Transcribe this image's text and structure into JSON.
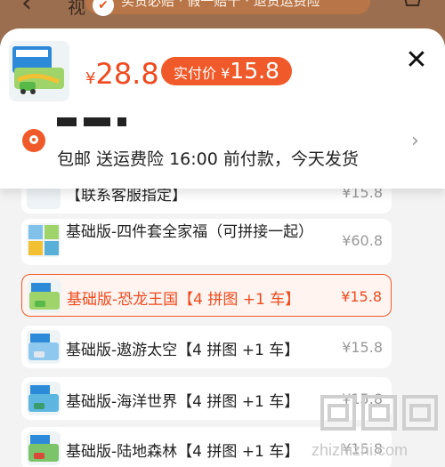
{
  "background": {
    "back_icon": "back-arrow-icon",
    "title_fragment": "视",
    "banner_text": "买贵必赔 · 假一赔十 · 退货运费险",
    "cart_icon": "cart-icon"
  },
  "header": {
    "price_symbol": "¥",
    "price_value": "28.8",
    "deal_label": "实付价",
    "deal_symbol": "¥",
    "deal_value": "15.8",
    "close_icon": "close-icon",
    "shipping_text": "包邮  送运费险  16:00 前付款，今天发货",
    "location_icon": "location-pin-icon",
    "chevron_icon": "chevron-right-icon"
  },
  "options": [
    {
      "name": "【联系客服指定】",
      "price": "¥15.8",
      "state": "partial"
    },
    {
      "name": "基础版-四件套全家福（可拼接一起）",
      "price": "¥60.8",
      "state": "normal"
    },
    {
      "name": "基础版-恐龙王国【4 拼图 +1 车】",
      "price": "¥15.8",
      "state": "selected"
    },
    {
      "name": "基础版-遨游太空【4 拼图 +1 车】",
      "price": "¥15.8",
      "state": "normal"
    },
    {
      "name": "基础版-海洋世界【4 拼图 +1 车】",
      "price": "¥15.8",
      "state": "normal"
    },
    {
      "name": "基础版-陆地森林【4 拼图 +1 车】",
      "price": "¥15.8",
      "state": "normal"
    }
  ],
  "watermark": {
    "text": "zhizhizhi.com"
  },
  "colors": {
    "accent": "#f04a1e",
    "badge": "#f05a2a",
    "selected_bg": "#fff4f0",
    "muted_price": "#999999"
  }
}
